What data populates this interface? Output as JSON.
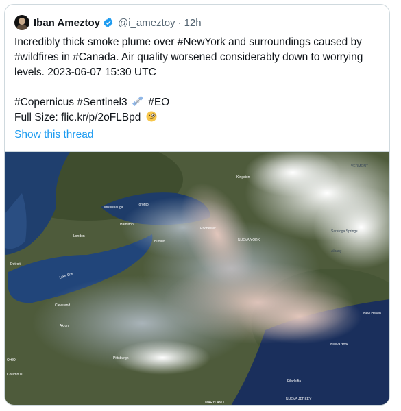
{
  "tweet": {
    "author_name": "Iban Ameztoy",
    "handle": "@i_ameztoy",
    "separator": "·",
    "time": "12h",
    "text_line1": "Incredibly thick smoke plume over #NewYork and surroundings caused by #wildfires in #Canada. Air quality worsened considerably down to worrying levels. 2023-06-07 15:30 UTC",
    "hashtags_line": "#Copernicus #Sentinel3",
    "hashtag_eo": "#EO",
    "fullsize_prefix": "Full Size: ",
    "fullsize_link": "flic.kr/p/2oFLBpd",
    "show_thread": "Show this thread"
  },
  "map_labels": {
    "kingston": "Kingston",
    "vermont": "VERMONT",
    "mississauga": "Mississauga",
    "toronto": "Toronto",
    "hamilton": "Hamilton",
    "rochester": "Rochester",
    "buffalo": "Buffalo",
    "london": "London",
    "nueva_york": "NUEVA YORK",
    "saratoga": "Saratoga Springs",
    "albany": "Albany",
    "detroit": "Detroit",
    "lake_erie": "Lake Erie",
    "cleveland": "Cleveland",
    "akron": "Akron",
    "new_haven": "New Haven",
    "ohio": "OHIO",
    "pittsburgh": "Pittsburgh",
    "nueva_york_city": "Nueva York",
    "columbus": "Columbus",
    "filadelfia": "Filadelfia",
    "nueva_jersey": "NUEVA JERSEY",
    "maryland": "MARYLAND"
  },
  "colors": {
    "link": "#1d9bf0",
    "muted": "#536471",
    "text": "#0f1419",
    "verified": "#1d9bf0"
  },
  "icons": [
    "verified-badge-icon",
    "satellite-icon",
    "monocle-face-icon"
  ]
}
